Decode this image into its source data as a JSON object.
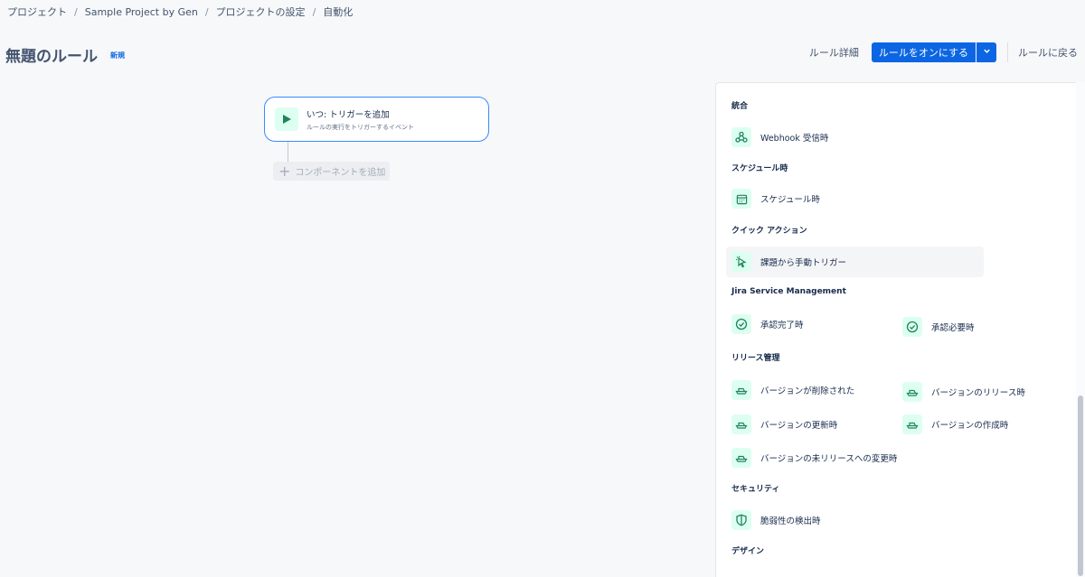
{
  "breadcrumb": [
    "プロジェクト",
    "Sample Project by Gen",
    "プロジェクトの設定",
    "自動化"
  ],
  "page": {
    "title": "無題のルール",
    "badge": "新規"
  },
  "header": {
    "rule_details": "ルール詳細",
    "turn_on": "ルールをオンにする",
    "back": "ルールに戻る"
  },
  "canvas": {
    "trigger_title": "いつ: トリガーを追加",
    "trigger_sub": "ルールの実行をトリガーするイベント",
    "add_component": "コンポーネントを追加"
  },
  "panel": {
    "sections": {
      "integration": "統合",
      "schedule": "スケジュール時",
      "quick": "クイック アクション",
      "jsm": "Jira Service Management",
      "release": "リリース管理",
      "security": "セキュリティ",
      "design": "デザイン"
    },
    "items": {
      "webhook": "Webhook 受信時",
      "schedule": "スケジュール時",
      "manual": "課題から手動トリガー",
      "approval_done": "承認完了時",
      "approval_needed": "承認必要時",
      "version_deleted": "バージョンが削除された",
      "version_released": "バージョンのリリース時",
      "version_updated": "バージョンの更新時",
      "version_created": "バージョンの作成時",
      "version_unreleased": "バージョンの未リリースへの変更時",
      "vuln": "脆弱性の検出時"
    }
  },
  "colors": {
    "accent": "#0c66e4",
    "icon_bg": "#dcfff1",
    "icon_fg": "#1f845a"
  }
}
